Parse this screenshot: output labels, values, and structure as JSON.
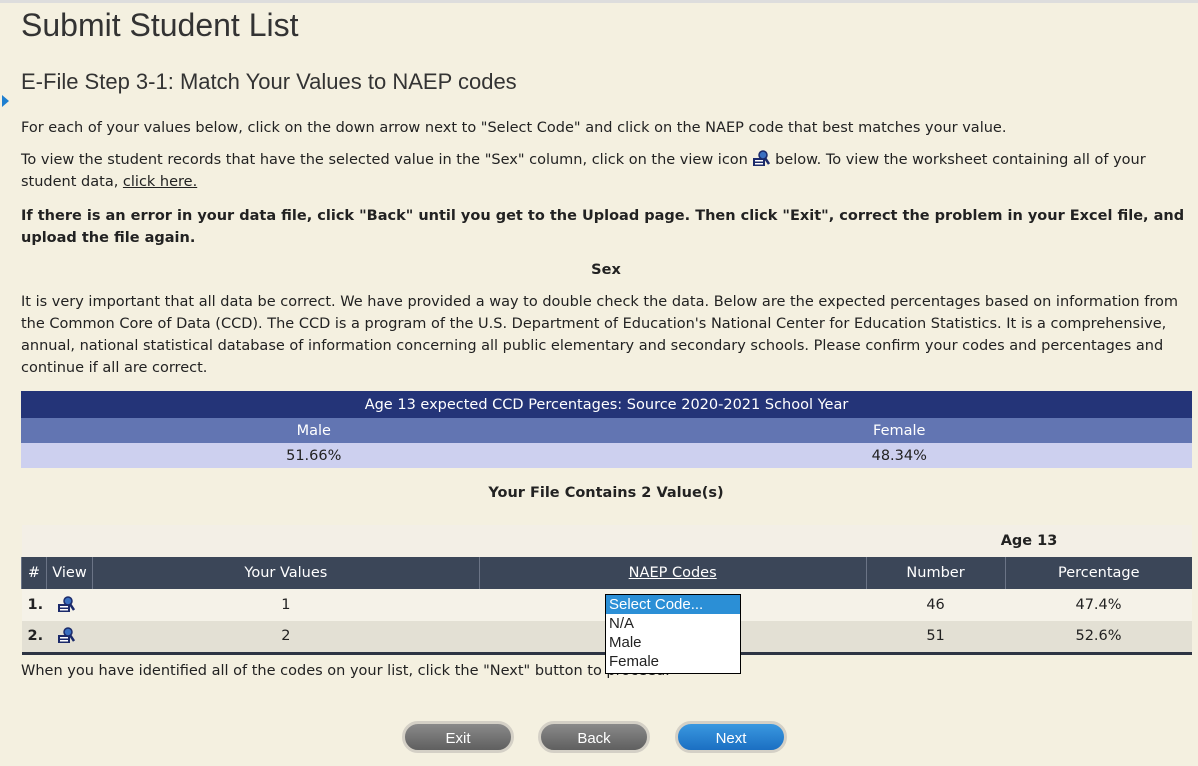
{
  "page": {
    "title": "Submit Student List",
    "subtitle": "E-File Step 3-1: Match Your Values to NAEP codes"
  },
  "instructions": {
    "p1": "For each of your values below, click on the down arrow next to \"Select Code\" and click on the NAEP code that best matches your value.",
    "p2a": "To view the student records that have the selected value in the \"Sex\" column, click on the view icon",
    "p2b": "below. To view the worksheet containing all of your student data,",
    "p2link": "click here.",
    "p3": "If there is an error in your data file, click \"Back\" until you get to the Upload page. Then click \"Exit\", correct the problem in your Excel file, and upload the file again.",
    "section": "Sex",
    "p4": "It is very important that all data be correct. We have provided a way to double check the data. Below are the expected percentages based on information from the Common Core of Data (CCD). The CCD is a program of the U.S. Department of Education's National Center for Education Statistics. It is a comprehensive, annual, national statistical database of information concerning all public elementary and secondary schools. Please confirm your codes and percentages and continue if all are correct."
  },
  "ccd": {
    "title": "Age 13 expected CCD Percentages: Source 2020-2021 School Year",
    "headers": [
      "Male",
      "Female"
    ],
    "values": [
      "51.66%",
      "48.34%"
    ]
  },
  "file_summary": "Your File Contains 2 Value(s)",
  "values_table": {
    "group_label": "Age 13",
    "headers": [
      "#",
      "View",
      "Your Values",
      "NAEP Codes",
      "Number",
      "Percentage"
    ],
    "rows": [
      {
        "num": "1.",
        "value": "1",
        "number": "46",
        "percentage": "47.4%"
      },
      {
        "num": "2.",
        "value": "2",
        "number": "51",
        "percentage": "52.6%"
      }
    ]
  },
  "dropdown": {
    "options": [
      "Select Code...",
      "N/A",
      "Male",
      "Female"
    ],
    "selected": "Select Code..."
  },
  "footer_text": "When you have identified all of the codes on your list, click the \"Next\" button to proceed.",
  "buttons": {
    "exit": "Exit",
    "back": "Back",
    "next": "Next"
  },
  "colors": {
    "accent": "#1b6fc2",
    "table_header": "#243478",
    "grid_header": "#3b4658"
  }
}
